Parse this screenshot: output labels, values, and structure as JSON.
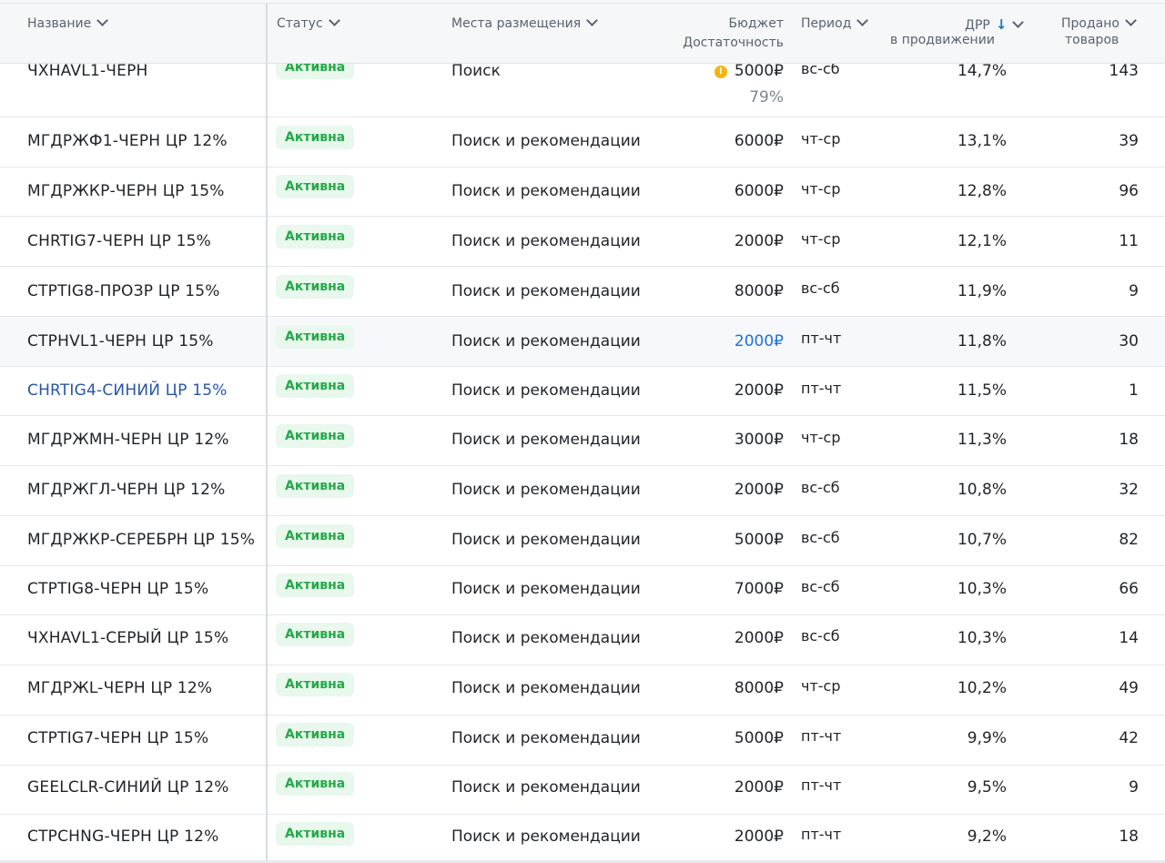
{
  "columns": {
    "name": "Название",
    "status": "Статус",
    "placement": "Места размещения",
    "budget": "Бюджет",
    "budget_sub": "Достаточность",
    "period": "Период",
    "drr": "ДРР",
    "drr_sub": "в продвижении",
    "sold_line1": "Продано",
    "sold_line2": "товаров"
  },
  "rows": [
    {
      "name": "ЧХHAVL1-ЧЕРН",
      "status": "Активна",
      "placement": "Поиск",
      "budget": "5000₽",
      "sufficiency": "79%",
      "period": "вс-сб",
      "drr": "14,7%",
      "sold": "143"
    },
    {
      "name": "МГДРЖФ1-ЧЕРН ЦР 12%",
      "status": "Активна",
      "placement": "Поиск и рекомендации",
      "budget": "6000₽",
      "period": "чт-ср",
      "drr": "13,1%",
      "sold": "39"
    },
    {
      "name": "МГДРЖКР-ЧЕРН ЦР 15%",
      "status": "Активна",
      "placement": "Поиск и рекомендации",
      "budget": "6000₽",
      "period": "чт-ср",
      "drr": "12,8%",
      "sold": "96"
    },
    {
      "name": "CHRTIG7-ЧЕРН ЦР 15%",
      "status": "Активна",
      "placement": "Поиск и рекомендации",
      "budget": "2000₽",
      "period": "чт-ср",
      "drr": "12,1%",
      "sold": "11"
    },
    {
      "name": "СТРTIG8-ПРОЗР ЦР 15%",
      "status": "Активна",
      "placement": "Поиск и рекомендации",
      "budget": "8000₽",
      "period": "вс-сб",
      "drr": "11,9%",
      "sold": "9"
    },
    {
      "name": "СТРHVL1-ЧЕРН ЦР 15%",
      "status": "Активна",
      "placement": "Поиск и рекомендации",
      "budget": "2000₽",
      "period": "пт-чт",
      "drr": "11,8%",
      "sold": "30"
    },
    {
      "name": "CHRTIG4-СИНИЙ ЦР 15%",
      "status": "Активна",
      "placement": "Поиск и рекомендации",
      "budget": "2000₽",
      "period": "пт-чт",
      "drr": "11,5%",
      "sold": "1"
    },
    {
      "name": "МГДРЖМН-ЧЕРН ЦР 12%",
      "status": "Активна",
      "placement": "Поиск и рекомендации",
      "budget": "3000₽",
      "period": "чт-ср",
      "drr": "11,3%",
      "sold": "18"
    },
    {
      "name": "МГДРЖГЛ-ЧЕРН ЦР 12%",
      "status": "Активна",
      "placement": "Поиск и рекомендации",
      "budget": "2000₽",
      "period": "вс-сб",
      "drr": "10,8%",
      "sold": "32"
    },
    {
      "name": "МГДРЖКР-СЕРЕБРН ЦР 15%",
      "status": "Активна",
      "placement": "Поиск и рекомендации",
      "budget": "5000₽",
      "period": "вс-сб",
      "drr": "10,7%",
      "sold": "82"
    },
    {
      "name": "СТРTIG8-ЧЕРН ЦР 15%",
      "status": "Активна",
      "placement": "Поиск и рекомендации",
      "budget": "7000₽",
      "period": "вс-сб",
      "drr": "10,3%",
      "sold": "66"
    },
    {
      "name": "ЧХHAVL1-СЕРЫЙ ЦР 15%",
      "status": "Активна",
      "placement": "Поиск и рекомендации",
      "budget": "2000₽",
      "period": "вс-сб",
      "drr": "10,3%",
      "sold": "14"
    },
    {
      "name": "МГДРЖL-ЧЕРН ЦР 12%",
      "status": "Активна",
      "placement": "Поиск и рекомендации",
      "budget": "8000₽",
      "period": "чт-ср",
      "drr": "10,2%",
      "sold": "49"
    },
    {
      "name": "СТРTIG7-ЧЕРН ЦР 15%",
      "status": "Активна",
      "placement": "Поиск и рекомендации",
      "budget": "5000₽",
      "period": "пт-чт",
      "drr": "9,9%",
      "sold": "42"
    },
    {
      "name": "GEELCLR-СИНИЙ ЦР 12%",
      "status": "Активна",
      "placement": "Поиск и рекомендации",
      "budget": "2000₽",
      "period": "пт-чт",
      "drr": "9,5%",
      "sold": "9"
    },
    {
      "name": "СТРCHNG-ЧЕРН ЦР 12%",
      "status": "Активна",
      "placement": "Поиск и рекомендации",
      "budget": "2000₽",
      "period": "пт-чт",
      "drr": "9,2%",
      "sold": "18"
    }
  ]
}
